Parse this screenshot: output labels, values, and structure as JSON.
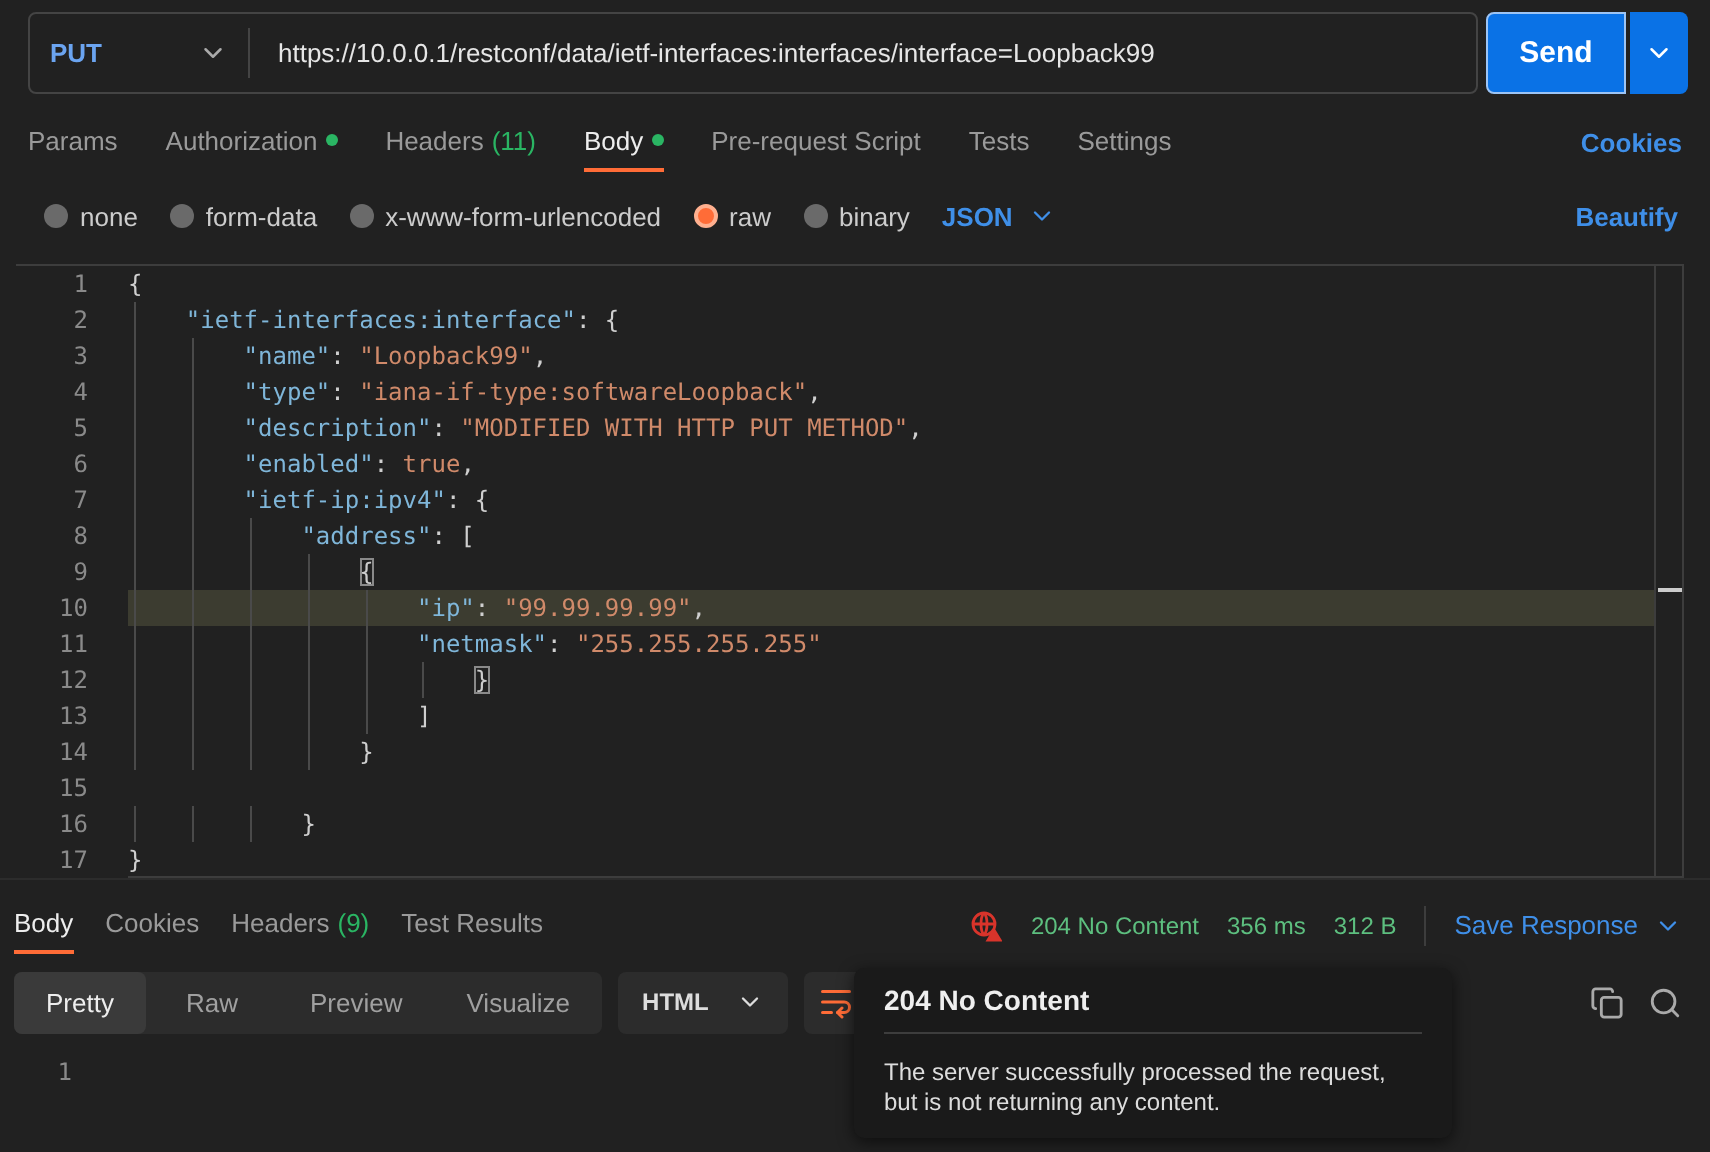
{
  "request": {
    "method": "PUT",
    "url": "https://10.0.0.1/restconf/data/ietf-interfaces:interfaces/interface=Loopback99",
    "send": "Send"
  },
  "tabs": [
    {
      "label": "Params",
      "selected": false
    },
    {
      "label": "Authorization",
      "selected": false,
      "dot": true
    },
    {
      "label": "Headers",
      "count": "(11)",
      "selected": false
    },
    {
      "label": "Body",
      "selected": true,
      "dot": true
    },
    {
      "label": "Pre-request Script",
      "selected": false
    },
    {
      "label": "Tests",
      "selected": false
    },
    {
      "label": "Settings",
      "selected": false
    }
  ],
  "cookies_link": "Cookies",
  "body_types": [
    {
      "label": "none",
      "selected": false
    },
    {
      "label": "form-data",
      "selected": false
    },
    {
      "label": "x-www-form-urlencoded",
      "selected": false
    },
    {
      "label": "raw",
      "selected": true
    },
    {
      "label": "binary",
      "selected": false
    }
  ],
  "format": "JSON",
  "beautify": "Beautify",
  "editor": {
    "lines": [
      {
        "number": "1",
        "tokens": [
          {
            "kind": "punct",
            "text": "{"
          }
        ]
      },
      {
        "number": "2",
        "tokens": [
          {
            "kind": "key",
            "text": "    \"ietf-interfaces:interface\""
          },
          {
            "kind": "punct",
            "text": ": {"
          }
        ]
      },
      {
        "number": "3",
        "tokens": [
          {
            "kind": "key",
            "text": "        \"name\""
          },
          {
            "kind": "punct",
            "text": ": "
          },
          {
            "kind": "string",
            "text": "\"Loopback99\""
          },
          {
            "kind": "punct",
            "text": ","
          }
        ]
      },
      {
        "number": "4",
        "tokens": [
          {
            "kind": "key",
            "text": "        \"type\""
          },
          {
            "kind": "punct",
            "text": ": "
          },
          {
            "kind": "string",
            "text": "\"iana-if-type:softwareLoopback\""
          },
          {
            "kind": "punct",
            "text": ","
          }
        ]
      },
      {
        "number": "5",
        "tokens": [
          {
            "kind": "key",
            "text": "        \"description\""
          },
          {
            "kind": "punct",
            "text": ": "
          },
          {
            "kind": "string",
            "text": "\"MODIFIED WITH HTTP PUT METHOD\""
          },
          {
            "kind": "punct",
            "text": ","
          }
        ]
      },
      {
        "number": "6",
        "tokens": [
          {
            "kind": "key",
            "text": "        \"enabled\""
          },
          {
            "kind": "punct",
            "text": ": "
          },
          {
            "kind": "string",
            "text": "true"
          },
          {
            "kind": "punct",
            "text": ","
          }
        ]
      },
      {
        "number": "7",
        "tokens": [
          {
            "kind": "key",
            "text": "        \"ietf-ip:ipv4\""
          },
          {
            "kind": "punct",
            "text": ": {"
          }
        ]
      },
      {
        "number": "8",
        "tokens": [
          {
            "kind": "key",
            "text": "            \"address\""
          },
          {
            "kind": "punct",
            "text": ": ["
          }
        ]
      },
      {
        "number": "9",
        "tokens": [
          {
            "kind": "bracket",
            "text": "                {",
            "matched": true
          }
        ]
      },
      {
        "number": "10",
        "highlighted": true,
        "tokens": [
          {
            "kind": "key",
            "text": "                    \"ip\""
          },
          {
            "kind": "punct",
            "text": ": "
          },
          {
            "kind": "string",
            "text": "\"99.99.99.99\""
          },
          {
            "kind": "punct",
            "text": ","
          }
        ]
      },
      {
        "number": "11",
        "tokens": [
          {
            "kind": "key",
            "text": "                    \"netmask\""
          },
          {
            "kind": "punct",
            "text": ": "
          },
          {
            "kind": "string",
            "text": "\"255.255.255.255\""
          }
        ]
      },
      {
        "number": "12",
        "tokens": [
          {
            "kind": "bracket",
            "text": "                        }",
            "matched": true
          }
        ]
      },
      {
        "number": "13",
        "tokens": [
          {
            "kind": "punct",
            "text": "                    ]"
          }
        ]
      },
      {
        "number": "14",
        "tokens": [
          {
            "kind": "punct",
            "text": "                }"
          }
        ]
      },
      {
        "number": "15"
      },
      {
        "number": "16",
        "tokens": [
          {
            "kind": "punct",
            "text": "            }"
          }
        ]
      },
      {
        "number": "17",
        "tokens": [
          {
            "kind": "punct",
            "text": "}"
          }
        ]
      }
    ]
  },
  "response": {
    "tabs": [
      {
        "label": "Body",
        "selected": true
      },
      {
        "label": "Cookies",
        "selected": false
      },
      {
        "label": "Headers",
        "count": "(9)",
        "selected": false
      },
      {
        "label": "Test Results",
        "selected": false
      }
    ],
    "status": "204 No Content",
    "time": "356 ms",
    "size": "312 B",
    "save": "Save Response",
    "views": [
      {
        "label": "Pretty",
        "selected": true
      },
      {
        "label": "Raw",
        "selected": false
      },
      {
        "label": "Preview",
        "selected": false
      },
      {
        "label": "Visualize",
        "selected": false
      }
    ],
    "language": "HTML",
    "line_numbers": [
      "1"
    ],
    "tooltip": {
      "title": "204 No Content",
      "text": "The server successfully processed the request, but is not returning any content."
    }
  }
}
